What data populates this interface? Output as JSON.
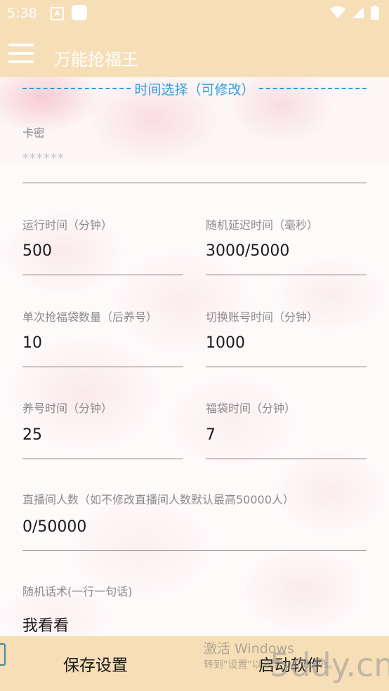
{
  "status_bar": {
    "time": "5:38",
    "a_icon": "A"
  },
  "app_bar": {
    "title": "万能抢福王"
  },
  "section": {
    "title": "时间选择（可修改）"
  },
  "fields": {
    "card_key": {
      "label": "卡密",
      "placeholder": "******",
      "value": ""
    },
    "run_time": {
      "label": "运行时间（分钟）",
      "value": "500"
    },
    "random_delay": {
      "label": "随机延迟时间（毫秒）",
      "value": "3000/5000"
    },
    "single_grab_count": {
      "label": "单次抢福袋数量（后养号）",
      "value": "10"
    },
    "switch_account_time": {
      "label": "切换账号时间（分钟）",
      "value": "1000"
    },
    "nurture_time": {
      "label": "养号时间（分钟）",
      "value": "25"
    },
    "lucky_bag_time": {
      "label": "福袋时间（分钟）",
      "value": "7"
    },
    "live_viewers": {
      "label": "直播间人数（如不修改直播间人数默认最高50000人）",
      "value": "0/50000"
    },
    "random_phrases": {
      "label": "随机话术(一行一句话)",
      "value": "我看看"
    }
  },
  "bottom_bar": {
    "save_label": "保存设置",
    "start_label": "启动软件"
  },
  "watermark": {
    "line1": "激活 Windows",
    "line2": "转到\"设置\"以激活 Windows。",
    "site": "5ddy.cn"
  },
  "colors": {
    "bar": "#f6deb6",
    "accent": "#2d9fe0"
  },
  "icons": [
    "menu-icon",
    "wifi-icon",
    "signal-icon",
    "battery-icon"
  ]
}
